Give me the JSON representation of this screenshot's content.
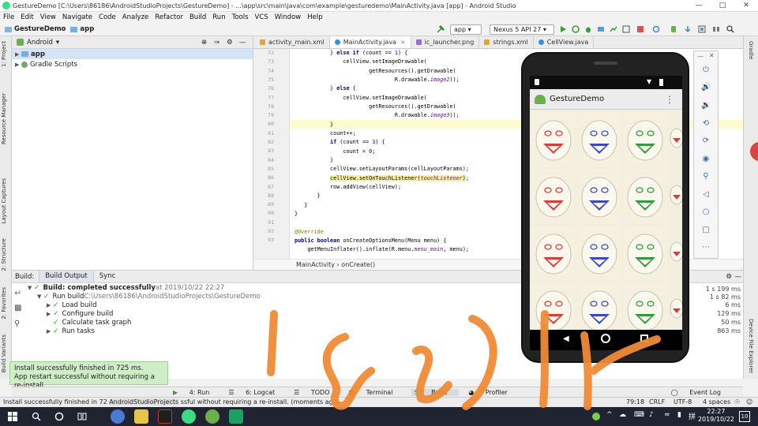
{
  "window": {
    "title": "GestureDemo [C:\\Users\\86186\\AndroidStudioProjects\\GestureDemo] - ...\\app\\src\\main\\java\\com\\example\\gesturedemo\\MainActivity.java [app] - Android Studio"
  },
  "menu": [
    "File",
    "Edit",
    "View",
    "Navigate",
    "Code",
    "Analyze",
    "Refactor",
    "Build",
    "Run",
    "Tools",
    "VCS",
    "Window",
    "Help"
  ],
  "toolbar": {
    "project": "GestureDemo",
    "module": "app",
    "run_config": "app",
    "device": "Nexus 5 API 27"
  },
  "project_panel": {
    "view": "Android",
    "items": [
      {
        "label": "app",
        "selected": true
      },
      {
        "label": "Gradle Scripts",
        "selected": false
      }
    ]
  },
  "left_tool_tabs": [
    "1: Project",
    "Resource Manager",
    "Layout Captures",
    "2: Structure",
    "2: Favorites",
    "Build Variants"
  ],
  "right_tool_tabs": [
    "Gradle",
    "Device File Explorer"
  ],
  "editor": {
    "tabs": [
      {
        "label": "activity_main.xml",
        "color": "#e8a33c"
      },
      {
        "label": "MainActivity.java",
        "color": "#3f8fd8",
        "active": true
      },
      {
        "label": "ic_launcher.png",
        "color": "#9a6fcf"
      },
      {
        "label": "strings.xml",
        "color": "#e8a33c"
      },
      {
        "label": "CellView.java",
        "color": "#3f8fd8"
      }
    ],
    "line_numbers": [
      "72",
      "73",
      "74",
      "75",
      "76",
      "77",
      "78",
      "79",
      "80",
      "81",
      "82",
      "83",
      "84",
      "85",
      "86",
      "87",
      "88",
      "89",
      "90",
      "91",
      "92",
      "93"
    ],
    "breadcrumb": "MainActivity  ›  onCreate()"
  },
  "build": {
    "panel_label": "Build:",
    "tabs": [
      "Build Output",
      "Sync"
    ],
    "rows": [
      {
        "text": "Build: completed successfully",
        "suffix": " at 2019/10/22 22:27",
        "time": "1 s 199 ms"
      },
      {
        "text": "Run build",
        "suffix": " C:\\Users\\86186\\AndroidStudioProjects\\GestureDemo",
        "time": "1 s 82 ms"
      },
      {
        "text": "Load build",
        "suffix": "",
        "time": "6 ms"
      },
      {
        "text": "Configure build",
        "suffix": "",
        "time": "129 ms"
      },
      {
        "text": "Calculate task graph",
        "suffix": "",
        "time": "50 ms"
      },
      {
        "text": "Run tasks",
        "suffix": "",
        "time": "863 ms"
      }
    ]
  },
  "toast": {
    "line1": "Install successfully finished in 725 ms.",
    "line2": "App restart successful without requiring a re-install."
  },
  "tool_windows": [
    "4: Run",
    "6: Logcat",
    "TODO",
    "Terminal",
    "Build",
    "Profiler"
  ],
  "event_log": "Event Log",
  "status": {
    "message": "Install successfully finished in 72",
    "path_fragment": "AndroidStudioProjects",
    "message_rest": "ssful without requiring a re-install. (moments ago)",
    "caret": "79:18",
    "line_sep": "CRLF",
    "encoding": "UTF-8",
    "indent": "4 spaces"
  },
  "emulator": {
    "app_title": "GestureDemo"
  },
  "taskbar": {
    "time": "22:27",
    "date": "2019/10/22",
    "badge": "10"
  },
  "colors": {
    "accent": "#3f8fd8",
    "success": "#3a9a3a",
    "annotation": "#f08a34"
  }
}
